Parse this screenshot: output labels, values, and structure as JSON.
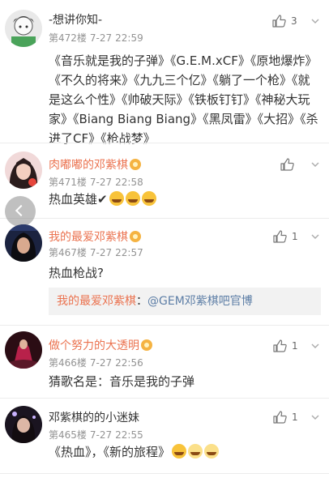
{
  "comments": [
    {
      "username": "-想讲你知-",
      "floor": "第472楼",
      "date": "7-27",
      "time": "22:59",
      "likes": "3",
      "text": "《音乐就是我的子弹》《G.E.M.xCF》《原地爆炸》《不久的将来》《九九三个亿》《躺了一个枪》《就是这么个性》《帅破天际》《铁板钉钉》《神秘大玩家》《Biang Biang Biang》《黑凤雷》《大招》《杀进了CF》《枪战梦》"
    },
    {
      "username": "肉嘟嘟的邓紫棋",
      "floor": "第471楼",
      "date": "7-27",
      "time": "22:58",
      "likes": "",
      "text": "热血英雄✔"
    },
    {
      "username": "我的最爱邓紫棋",
      "floor": "第467楼",
      "date": "7-27",
      "time": "22:57",
      "likes": "1",
      "text": "热血枪战?",
      "reply": {
        "prefix": "我的最爱邓紫棋",
        "sep": "：",
        "mention": "@GEM邓紫棋吧官博"
      }
    },
    {
      "username": "做个努力的大透明",
      "floor": "第466楼",
      "date": "7-27",
      "time": "22:56",
      "likes": "1",
      "text": "猜歌名是：音乐是我的子弹"
    },
    {
      "username": "邓紫棋的的小迷妹",
      "floor": "第465楼",
      "date": "7-27",
      "time": "22:55",
      "likes": "1",
      "text": "《热血》，《新的旅程》"
    }
  ],
  "icons": {
    "like": "thumbs-up-icon",
    "more": "chevron-down-icon",
    "back": "chevron-left-icon",
    "vip": "vip-badge-icon"
  },
  "colors": {
    "accent": "#eb7350",
    "mention": "#5d7ea6",
    "meta": "#939393"
  }
}
